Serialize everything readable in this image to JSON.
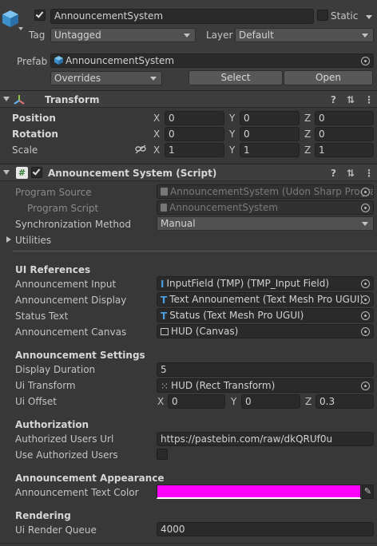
{
  "header": {
    "object_name": "AnnouncementSystem",
    "static_label": "Static",
    "tag_label": "Tag",
    "tag_value": "Untagged",
    "layer_label": "Layer",
    "layer_value": "Default",
    "prefab_label": "Prefab",
    "prefab_value": "AnnouncementSystem",
    "overrides_label": "Overrides",
    "select_label": "Select",
    "open_label": "Open"
  },
  "transform": {
    "title": "Transform",
    "position_label": "Position",
    "rotation_label": "Rotation",
    "scale_label": "Scale",
    "x_label": "X",
    "y_label": "Y",
    "z_label": "Z",
    "position": {
      "x": "0",
      "y": "0",
      "z": "0"
    },
    "rotation": {
      "x": "0",
      "y": "0",
      "z": "0"
    },
    "scale": {
      "x": "1",
      "y": "1",
      "z": "1"
    }
  },
  "script": {
    "title": "Announcement System (Script)",
    "program_source_label": "Program Source",
    "program_source_value": "AnnouncementSystem (Udon Sharp Progra",
    "program_script_label": "Program Script",
    "program_script_value": "AnnouncementSystem",
    "sync_label": "Synchronization Method",
    "sync_value": "Manual",
    "utilities_label": "Utilities",
    "ui_refs_heading": "UI References",
    "input_label": "Announcement Input",
    "input_value": "InputField (TMP) (TMP_Input Field)",
    "display_label": "Announcement Display",
    "display_value": "Text Announement (Text Mesh Pro UGUI)",
    "status_label": "Status Text",
    "status_value": "Status (Text Mesh Pro UGUI)",
    "canvas_label": "Announcement Canvas",
    "canvas_value": "HUD (Canvas)",
    "settings_heading": "Announcement Settings",
    "duration_label": "Display Duration",
    "duration_value": "5",
    "ui_transform_label": "Ui Transform",
    "ui_transform_value": "HUD (Rect Transform)",
    "ui_offset_label": "Ui Offset",
    "ui_offset": {
      "x": "0",
      "y": "0",
      "z": "0.3"
    },
    "auth_heading": "Authorization",
    "auth_url_label": "Authorized Users Url",
    "auth_url_value": "https://pastebin.com/raw/dkQRUf0u",
    "use_auth_label": "Use Authorized Users",
    "appearance_heading": "Announcement Appearance",
    "text_color_label": "Announcement Text Color",
    "text_color": "#ff00ff",
    "rendering_heading": "Rendering",
    "render_queue_label": "Ui Render Queue",
    "render_queue_value": "4000"
  },
  "colors": {
    "panel_bg": "#383838",
    "field_bg": "#2a2a2a",
    "accent_blue": "#4a9fe0"
  },
  "icons": [
    "cube-icon",
    "transform-axes-icon",
    "script-hash-icon",
    "help-icon",
    "settings-icon",
    "menu-dots-icon",
    "object-picker-icon",
    "link-icon",
    "color-picker-icon"
  ]
}
